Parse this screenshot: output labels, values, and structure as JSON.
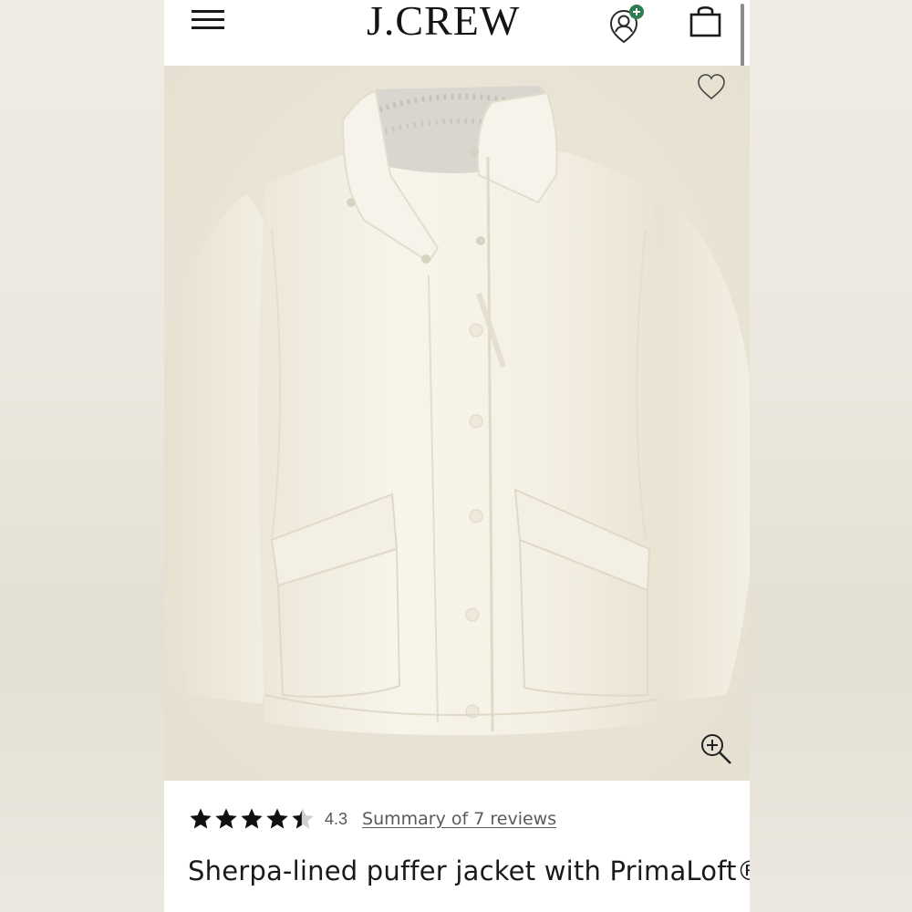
{
  "header": {
    "brand": "J.CREW",
    "menu_icon": "hamburger-menu-icon",
    "account_icon": "account-add-icon",
    "bag_icon": "shopping-bag-icon"
  },
  "product": {
    "image_alt": "Sherpa-lined puffer jacket in ivory",
    "wishlist_icon": "heart-icon",
    "zoom_icon": "zoom-in-icon",
    "rating": {
      "stars": 4.3,
      "max": 5,
      "value_label": "4.3",
      "reviews_label": "Summary of 7 reviews"
    },
    "title": "Sherpa-lined puffer jacket with PrimaLoft®"
  },
  "colors": {
    "brand_green": "#2e7d4f",
    "text_primary": "#1a1a1a",
    "text_secondary": "#5a5a5a",
    "image_background": "#ebe6d9",
    "jacket": "#f5f2e7"
  }
}
